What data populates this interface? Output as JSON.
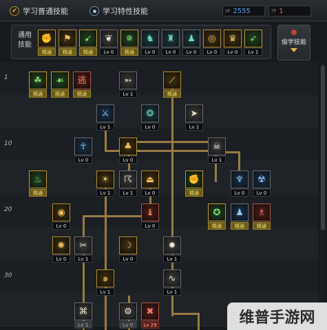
{
  "tabs": [
    {
      "label": "学习普通技能",
      "icon": "check-icon"
    },
    {
      "label": "学习特性技能",
      "icon": "radio-icon"
    }
  ],
  "sp": {
    "label": "SP",
    "value": "2555",
    "color": "#5aa0ff"
  },
  "tp": {
    "label": "TP",
    "value": "1",
    "color": "#ff5a4a"
  },
  "common_skills": {
    "label": "通用\n技能",
    "items": [
      {
        "icon": "fist-icon",
        "glyph": "✊",
        "cap": "精通",
        "style": "gold",
        "cap_style": "special"
      },
      {
        "icon": "boot-icon",
        "glyph": "⚑",
        "cap": "精通",
        "style": "gold",
        "cap_style": "special"
      },
      {
        "icon": "kick-icon",
        "glyph": "➹",
        "cap": "精通",
        "style": "green",
        "cap_style": "special"
      },
      {
        "icon": "wing-icon",
        "glyph": "❦",
        "cap": "Lv 0",
        "style": "white",
        "cap_style": "normal"
      },
      {
        "icon": "sigil-icon",
        "glyph": "✵",
        "cap": "精通",
        "style": "green",
        "cap_style": "special"
      },
      {
        "icon": "jump-icon",
        "glyph": "♞",
        "cap": "Lv 0",
        "style": "teal",
        "cap_style": "normal"
      },
      {
        "icon": "slam-icon",
        "glyph": "♜",
        "cap": "Lv 0",
        "style": "teal",
        "cap_style": "normal"
      },
      {
        "icon": "leap-icon",
        "glyph": "♟",
        "cap": "Lv 0",
        "style": "teal",
        "cap_style": "normal"
      },
      {
        "icon": "ring-icon",
        "glyph": "◎",
        "cap": "Lv 0",
        "style": "gold",
        "cap_style": "normal"
      },
      {
        "icon": "guard-icon",
        "glyph": "♛",
        "cap": "Lv 0",
        "style": "gold",
        "cap_style": "normal"
      },
      {
        "icon": "run-icon",
        "glyph": "➶",
        "cap": "Lv 1",
        "style": "green",
        "cap_style": "normal"
      }
    ]
  },
  "learn_button": {
    "label": "偷学技能"
  },
  "level_markers": [
    "1",
    "10",
    "20",
    "30"
  ],
  "tree": [
    {
      "icon": "claw-icon",
      "glyph": "☘",
      "cap": "精通",
      "style": "green",
      "cap_style": "special"
    },
    {
      "icon": "dash-icon",
      "glyph": "☙",
      "cap": "精通",
      "style": "green",
      "cap_style": "special"
    },
    {
      "icon": "escape-icon",
      "glyph": "逃",
      "cap": "精通",
      "style": "red",
      "cap_style": "special"
    },
    {
      "icon": "arrow-icon",
      "glyph": "➳",
      "cap": "Lv 1",
      "style": "white",
      "cap_style": "normal"
    },
    {
      "icon": "slash-icon",
      "glyph": "⟋",
      "cap": "精通",
      "style": "gold",
      "cap_style": "special"
    },
    {
      "icon": "blade-icon",
      "glyph": "⚔",
      "cap": "Lv 1",
      "style": "blue",
      "cap_style": "normal"
    },
    {
      "icon": "swirl-icon",
      "glyph": "❂",
      "cap": "Lv 0",
      "style": "teal",
      "cap_style": "normal"
    },
    {
      "icon": "chevron-icon",
      "glyph": "➤",
      "cap": "Lv 1",
      "style": "white",
      "cap_style": "normal"
    },
    {
      "icon": "ankh-icon",
      "glyph": "☥",
      "cap": "Lv 0",
      "style": "blue",
      "cap_style": "normal"
    },
    {
      "icon": "stomp-icon",
      "glyph": "♣",
      "cap": "Lv 0",
      "style": "gold",
      "cap_style": "normal"
    },
    {
      "icon": "beast-icon",
      "glyph": "☠",
      "cap": "Lv 1",
      "style": "white",
      "cap_style": "normal"
    },
    {
      "icon": "rage-icon",
      "glyph": "♨",
      "cap": "精通",
      "style": "green",
      "cap_style": "special"
    },
    {
      "icon": "orb-icon",
      "glyph": "☀",
      "cap": "Lv 1",
      "style": "gold",
      "cap_style": "normal"
    },
    {
      "icon": "hook-icon",
      "glyph": "☈",
      "cap": "Lv 1",
      "style": "white",
      "cap_style": "normal"
    },
    {
      "icon": "pillar-icon",
      "glyph": "⏏",
      "cap": "Lv 0",
      "style": "gold",
      "cap_style": "normal"
    },
    {
      "icon": "fist-green-icon",
      "glyph": "✊",
      "cap": "精通",
      "style": "green",
      "cap_style": "special"
    },
    {
      "icon": "demon-icon",
      "glyph": "♆",
      "cap": "Lv 0",
      "style": "blue",
      "cap_style": "normal"
    },
    {
      "icon": "skull-icon",
      "glyph": "☢",
      "cap": "Lv 0",
      "style": "blue",
      "cap_style": "normal"
    },
    {
      "icon": "eye-icon",
      "glyph": "◉",
      "cap": "Lv 0",
      "style": "gold",
      "cap_style": "normal"
    },
    {
      "icon": "scythe-icon",
      "glyph": "♝",
      "cap": "Lv 0",
      "style": "red",
      "cap_style": "normal"
    },
    {
      "icon": "warrior-icon",
      "glyph": "✪",
      "cap": "精通",
      "style": "green",
      "cap_style": "special"
    },
    {
      "icon": "wraith-icon",
      "glyph": "♟",
      "cap": "精通",
      "style": "blue",
      "cap_style": "special"
    },
    {
      "icon": "ghost-icon",
      "glyph": "♗",
      "cap": "精通",
      "style": "red",
      "cap_style": "special"
    },
    {
      "icon": "roar-icon",
      "glyph": "✺",
      "cap": "Lv 0",
      "style": "gold",
      "cap_style": "normal"
    },
    {
      "icon": "cleave-icon",
      "glyph": "✂",
      "cap": "Lv 1",
      "style": "white",
      "cap_style": "normal"
    },
    {
      "icon": "crescent-icon",
      "glyph": "☽",
      "cap": "Lv 0",
      "style": "gold",
      "cap_style": "normal"
    },
    {
      "icon": "burst-icon",
      "glyph": "✹",
      "cap": "Lv 1",
      "style": "white",
      "cap_style": "normal"
    },
    {
      "icon": "spiral-icon",
      "glyph": "๑",
      "cap": "Lv 1",
      "style": "gold",
      "cap_style": "normal"
    },
    {
      "icon": "wave-icon",
      "glyph": "∿",
      "cap": "Lv 1",
      "style": "white",
      "cap_style": "normal"
    },
    {
      "icon": "rune-icon",
      "glyph": "⌘",
      "cap": "Lv 1",
      "style": "white",
      "cap_style": "faded"
    },
    {
      "icon": "seal-icon",
      "glyph": "⚙",
      "cap": "Lv 0",
      "style": "white",
      "cap_style": "faded"
    },
    {
      "icon": "cross-icon",
      "glyph": "✖",
      "cap": "Lv 29",
      "style": "red",
      "cap_style": "red"
    }
  ],
  "watermark": "维普手游网"
}
